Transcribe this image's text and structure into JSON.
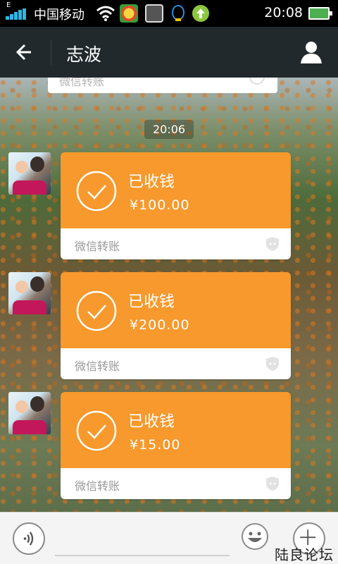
{
  "status_bar": {
    "network_letter": "E",
    "carrier": "中国移动",
    "time": "20:08"
  },
  "header": {
    "title": "志波",
    "back_icon": "arrow-left-icon",
    "profile_icon": "person-icon"
  },
  "chat": {
    "previous_card": {
      "label": "微信转账"
    },
    "time_label": "20:06",
    "messages": [
      {
        "status": "已收钱",
        "amount": "¥100.00",
        "service": "微信转账"
      },
      {
        "status": "已收钱",
        "amount": "¥200.00",
        "service": "微信转账"
      },
      {
        "status": "已收钱",
        "amount": "¥15.00",
        "service": "微信转账"
      }
    ]
  },
  "input_bar": {
    "watermark": "陆良论坛"
  },
  "colors": {
    "card_orange": "#f7992c",
    "titlebar": "#22292c",
    "signal_blue": "#33b5e5"
  }
}
